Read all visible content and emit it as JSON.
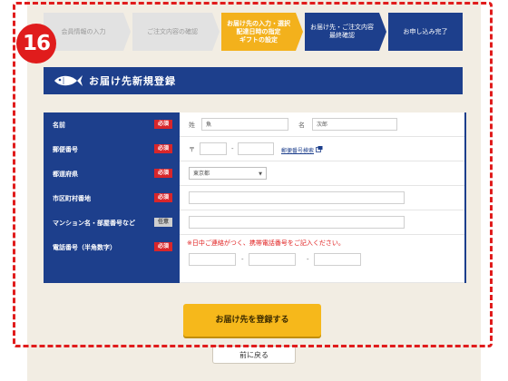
{
  "badge": "16",
  "steps": [
    "会員情報の入力",
    "ご注文内容の確認",
    "お届け先の入力・選択\n配達日時の指定\nギフトの設定",
    "お届け先・ご注文内容\n最終確認",
    "お申し込み完了"
  ],
  "header": {
    "title": "お届け先新規登録",
    "icon": "fish-icon"
  },
  "form": {
    "required_label": "必須",
    "optional_label": "任意",
    "rows": {
      "name": {
        "label": "名前",
        "sei_label": "姓",
        "sei_value": "魚",
        "mei_label": "名",
        "mei_value": "次郎"
      },
      "postal": {
        "label": "郵便番号",
        "prefix": "〒",
        "sep": "-",
        "lookup_link": "郵便番号検索"
      },
      "pref": {
        "label": "都道府県",
        "selected": "東京都"
      },
      "city": {
        "label": "市区町村番地"
      },
      "building": {
        "label": "マンション名・部屋番号など"
      },
      "phone": {
        "label": "電話番号（半角数字）",
        "note": "※日中ご連絡がつく、携帯電話番号をご記入ください。",
        "sep1": "-",
        "sep2": "-"
      }
    }
  },
  "buttons": {
    "submit": "お届け先を登録する",
    "back": "前に戻る"
  },
  "colors": {
    "navy": "#1d3f8c",
    "accent_yellow": "#f6b81b",
    "alert_red": "#e01c1c",
    "paper": "#f2ede3"
  }
}
